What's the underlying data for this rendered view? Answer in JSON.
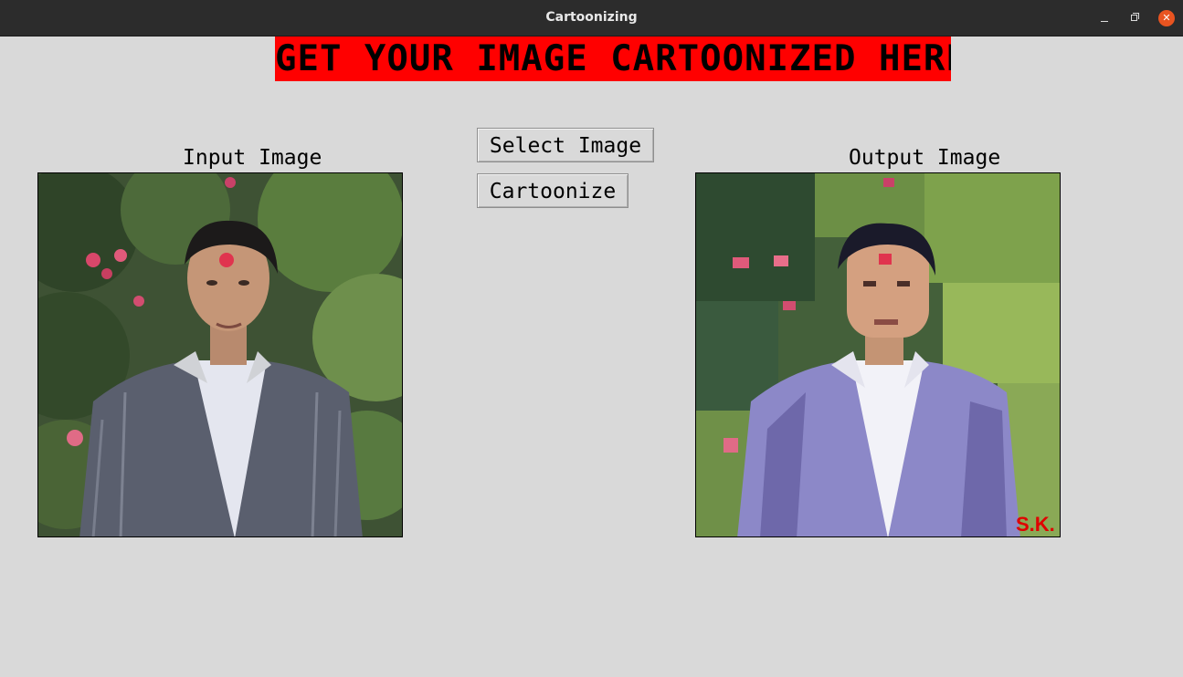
{
  "window": {
    "title": "Cartoonizing",
    "controls": {
      "minimize": "minimize-icon",
      "maximize": "restore-icon",
      "close_glyph": "✕"
    },
    "accent_close": "#e95420"
  },
  "banner": {
    "text": "GET YOUR IMAGE CARTOONIZED HERE!",
    "background": "#ff0000"
  },
  "buttons": {
    "select_label": "Select Image",
    "cartoonize_label": "Cartoonize"
  },
  "panels": {
    "input_caption": "Input Image",
    "output_caption": "Output Image",
    "output_watermark": "S.K."
  }
}
